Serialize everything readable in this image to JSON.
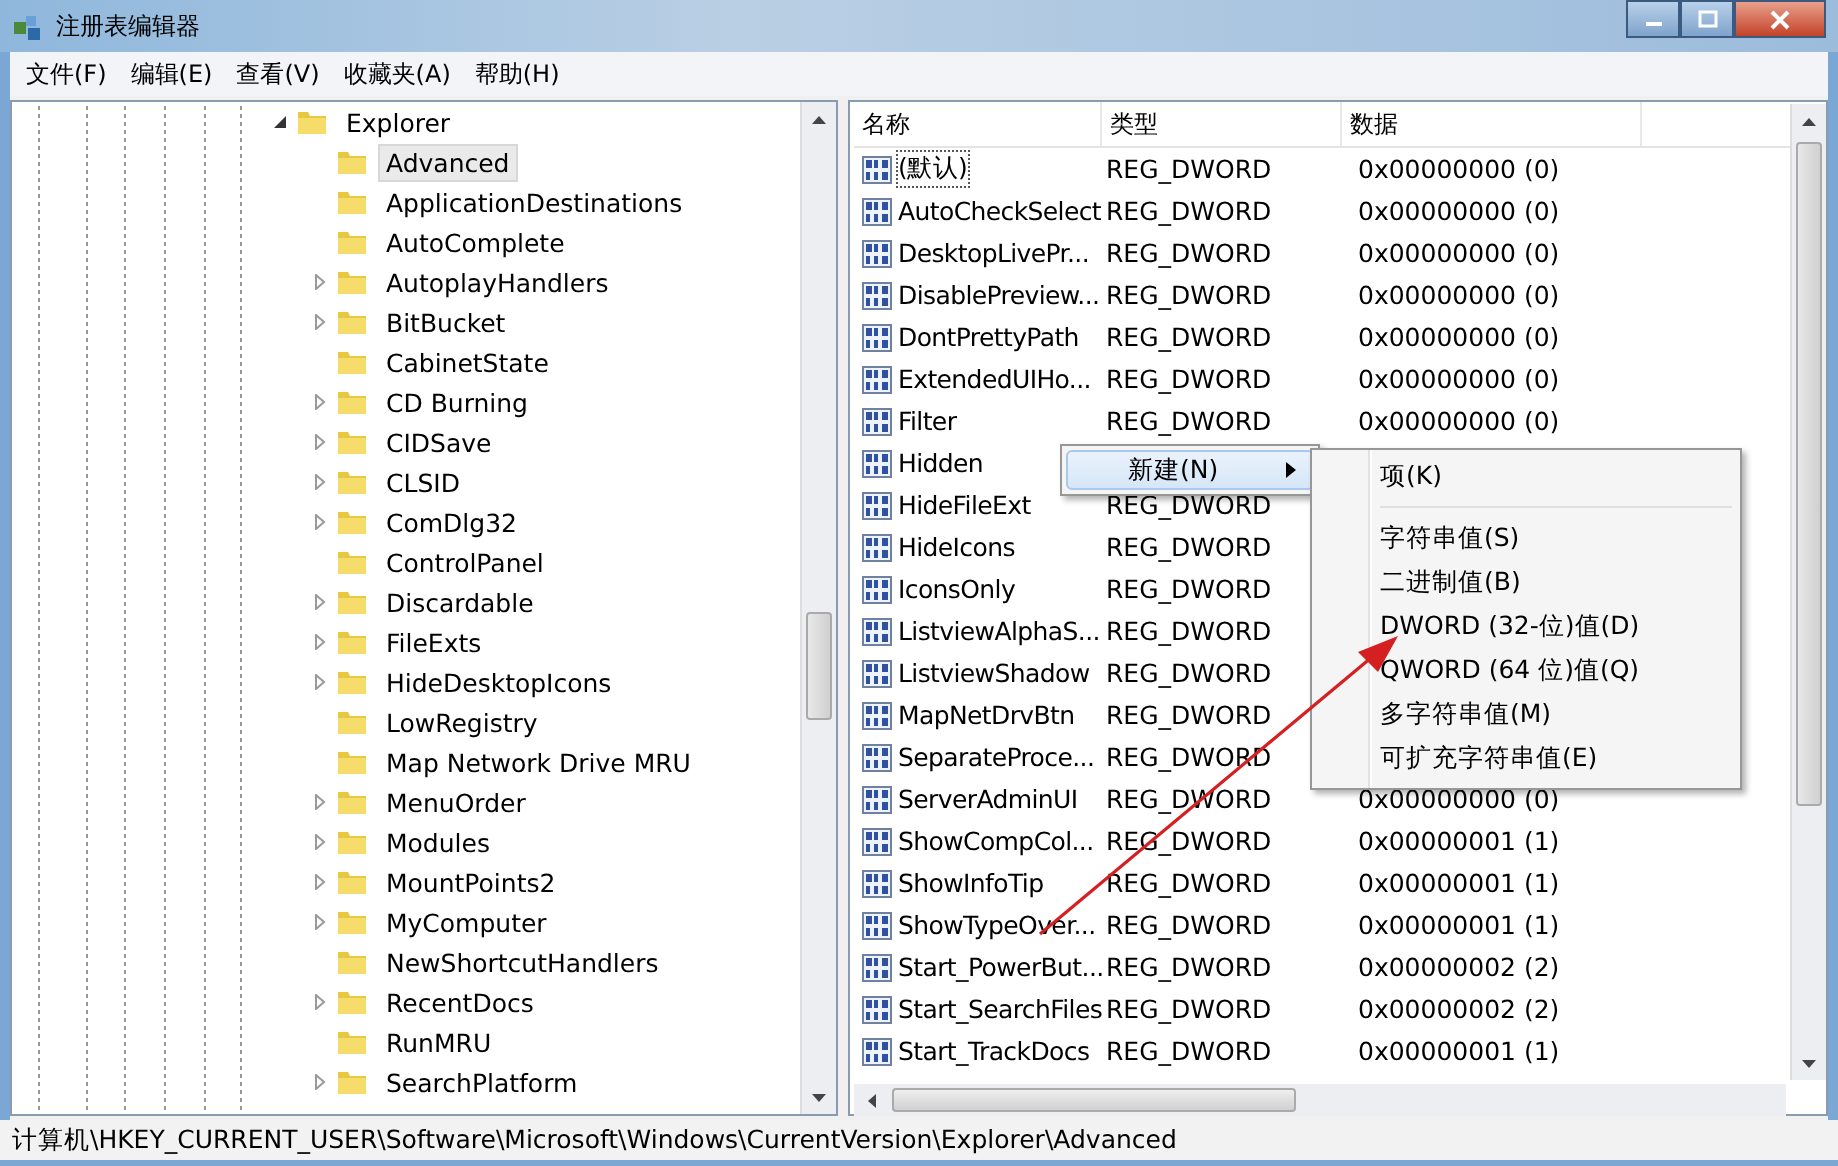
{
  "window": {
    "title": "注册表编辑器"
  },
  "menu": [
    "文件(F)",
    "编辑(E)",
    "查看(V)",
    "收藏夹(A)",
    "帮助(H)"
  ],
  "tree": [
    {
      "label": "Explorer",
      "expanded": true,
      "selected": false,
      "children": [
        {
          "label": "Advanced",
          "selected": true,
          "expandable": false
        },
        {
          "label": "ApplicationDestinations",
          "selected": false,
          "expandable": false
        },
        {
          "label": "AutoComplete",
          "selected": false,
          "expandable": false
        },
        {
          "label": "AutoplayHandlers",
          "selected": false,
          "expandable": true
        },
        {
          "label": "BitBucket",
          "selected": false,
          "expandable": true
        },
        {
          "label": "CabinetState",
          "selected": false,
          "expandable": false
        },
        {
          "label": "CD Burning",
          "selected": false,
          "expandable": true
        },
        {
          "label": "CIDSave",
          "selected": false,
          "expandable": true
        },
        {
          "label": "CLSID",
          "selected": false,
          "expandable": true
        },
        {
          "label": "ComDlg32",
          "selected": false,
          "expandable": true
        },
        {
          "label": "ControlPanel",
          "selected": false,
          "expandable": false
        },
        {
          "label": "Discardable",
          "selected": false,
          "expandable": true
        },
        {
          "label": "FileExts",
          "selected": false,
          "expandable": true
        },
        {
          "label": "HideDesktopIcons",
          "selected": false,
          "expandable": true
        },
        {
          "label": "LowRegistry",
          "selected": false,
          "expandable": false
        },
        {
          "label": "Map Network Drive MRU",
          "selected": false,
          "expandable": false
        },
        {
          "label": "MenuOrder",
          "selected": false,
          "expandable": true
        },
        {
          "label": "Modules",
          "selected": false,
          "expandable": true
        },
        {
          "label": "MountPoints2",
          "selected": false,
          "expandable": true
        },
        {
          "label": "MyComputer",
          "selected": false,
          "expandable": true
        },
        {
          "label": "NewShortcutHandlers",
          "selected": false,
          "expandable": false
        },
        {
          "label": "RecentDocs",
          "selected": false,
          "expandable": true
        },
        {
          "label": "RunMRU",
          "selected": false,
          "expandable": false
        },
        {
          "label": "SearchPlatform",
          "selected": false,
          "expandable": true
        }
      ]
    }
  ],
  "list": {
    "columns": [
      "名称",
      "类型",
      "数据"
    ],
    "rows": [
      {
        "name": "(默认)",
        "type": "REG_DWORD",
        "data": "0x00000000 (0)",
        "focused": true
      },
      {
        "name": "AutoCheckSelect",
        "type": "REG_DWORD",
        "data": "0x00000000 (0)",
        "focused": false
      },
      {
        "name": "DesktopLivePr...",
        "type": "REG_DWORD",
        "data": "0x00000000 (0)",
        "focused": false
      },
      {
        "name": "DisablePreview...",
        "type": "REG_DWORD",
        "data": "0x00000000 (0)",
        "focused": false
      },
      {
        "name": "DontPrettyPath",
        "type": "REG_DWORD",
        "data": "0x00000000 (0)",
        "focused": false
      },
      {
        "name": "ExtendedUIHo...",
        "type": "REG_DWORD",
        "data": "0x00000000 (0)",
        "focused": false
      },
      {
        "name": "Filter",
        "type": "REG_DWORD",
        "data": "0x00000000 (0)",
        "focused": false
      },
      {
        "name": "Hidden",
        "focused": false
      },
      {
        "name": "HideFileExt",
        "type": "REG_DWORD",
        "focused": false
      },
      {
        "name": "HideIcons",
        "type": "REG_DWORD",
        "focused": false
      },
      {
        "name": "IconsOnly",
        "type": "REG_DWORD",
        "focused": false
      },
      {
        "name": "ListviewAlphaS...",
        "type": "REG_DWORD",
        "focused": false
      },
      {
        "name": "ListviewShadow",
        "type": "REG_DWORD",
        "focused": false
      },
      {
        "name": "MapNetDrvBtn",
        "type": "REG_DWORD",
        "focused": false
      },
      {
        "name": "SeparateProce...",
        "type": "REG_DWORD",
        "focused": false
      },
      {
        "name": "ServerAdminUI",
        "type": "REG_DWORD",
        "data": "0x00000000 (0)",
        "focused": false
      },
      {
        "name": "ShowCompCol...",
        "type": "REG_DWORD",
        "data": "0x00000001 (1)",
        "focused": false
      },
      {
        "name": "ShowInfoTip",
        "type": "REG_DWORD",
        "data": "0x00000001 (1)",
        "focused": false
      },
      {
        "name": "ShowTypeOver...",
        "type": "REG_DWORD",
        "data": "0x00000001 (1)",
        "focused": false
      },
      {
        "name": "Start_PowerBut...",
        "type": "REG_DWORD",
        "data": "0x00000002 (2)",
        "focused": false
      },
      {
        "name": "Start_SearchFiles",
        "type": "REG_DWORD",
        "data": "0x00000002 (2)",
        "focused": false
      },
      {
        "name": "Start_TrackDocs",
        "type": "REG_DWORD",
        "data": "0x00000001 (1)",
        "focused": false
      }
    ]
  },
  "context_menu": {
    "items": [
      {
        "label": "新建(N)",
        "selected": true
      }
    ]
  },
  "submenu": {
    "items": [
      {
        "kind": "item",
        "label": "项(K)"
      },
      {
        "kind": "separator"
      },
      {
        "kind": "item",
        "label": "字符串值(S)"
      },
      {
        "kind": "item",
        "label": "二进制值(B)"
      },
      {
        "kind": "item",
        "label": "DWORD (32-位)值(D)"
      },
      {
        "kind": "item",
        "label": "QWORD (64 位)值(Q)"
      },
      {
        "kind": "item",
        "label": "多字符串值(M)"
      },
      {
        "kind": "item",
        "label": "可扩充字符串值(E)"
      }
    ]
  },
  "status_bar": "计算机\\HKEY_CURRENT_USER\\Software\\Microsoft\\Windows\\CurrentVersion\\Explorer\\Advanced"
}
